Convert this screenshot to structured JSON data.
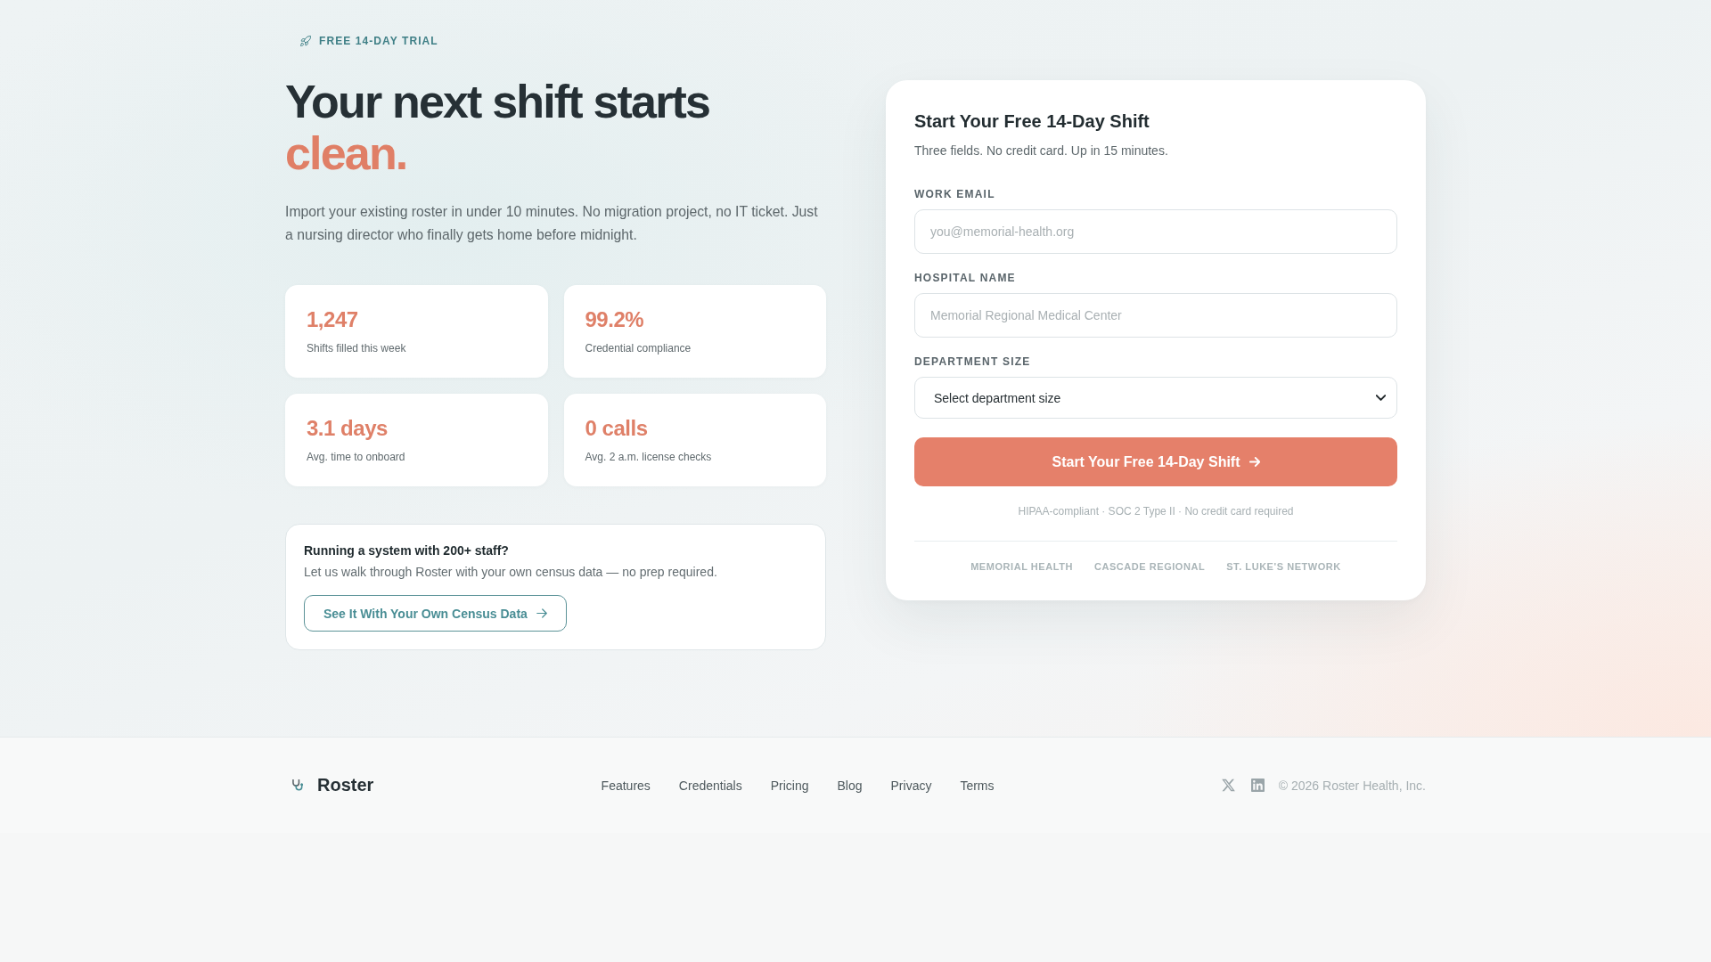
{
  "hero": {
    "badge": "FREE 14-DAY TRIAL",
    "heading": "Your next shift starts",
    "heading_accent": "clean.",
    "description": "Import your existing roster in under 10 minutes. No migration project, no IT ticket. Just a nursing director who finally gets home before midnight.",
    "stats": [
      {
        "value": "1,247",
        "label": "Shifts filled this week"
      },
      {
        "value": "99.2%",
        "label": "Credential compliance"
      },
      {
        "value": "3.1 days",
        "label": "Avg. time to onboard"
      },
      {
        "value": "0 calls",
        "label": "Avg. 2 a.m. license checks"
      }
    ],
    "demo_card": {
      "title": "Running a system with 200+ staff?",
      "text": "Let us walk through Roster with your own census data — no prep required.",
      "button": "See It With Your Own Census Data"
    }
  },
  "signup_form": {
    "title": "Start Your Free 14-Day Shift",
    "subtitle": "Three fields. No credit card. Up in 15 minutes.",
    "fields": [
      {
        "kind": "input",
        "label": "WORK EMAIL",
        "placeholder": "you@memorial-health.org"
      },
      {
        "kind": "input",
        "label": "HOSPITAL NAME",
        "placeholder": "Memorial Regional Medical Center"
      },
      {
        "kind": "select",
        "label": "DEPARTMENT SIZE",
        "value": "Select department size"
      }
    ],
    "submit_button": "Start Your Free 14-Day Shift",
    "fine_print": "HIPAA-compliant · SOC 2 Type II · No credit card required",
    "trusted_by": [
      "MEMORIAL HEALTH",
      "CASCADE REGIONAL",
      "ST. LUKE'S NETWORK"
    ]
  },
  "footer": {
    "brand": "Roster",
    "links": [
      "Features",
      "Credentials",
      "Pricing",
      "Blog",
      "Privacy",
      "Terms"
    ],
    "copyright": "© 2026 Roster Health, Inc."
  }
}
